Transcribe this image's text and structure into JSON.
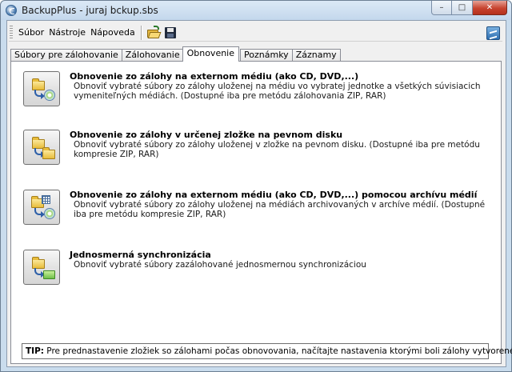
{
  "window": {
    "title": "BackupPlus - juraj bckup.sbs",
    "minimize_label": "–",
    "maximize_label": "□",
    "close_label": "✕"
  },
  "menu": {
    "items": [
      "Súbor",
      "Nástroje",
      "Nápoveda"
    ]
  },
  "toolbar": {
    "icons": [
      "open-folder-icon",
      "save-disk-icon",
      "brand-icon"
    ]
  },
  "tabs": [
    {
      "label": "Súbory pre zálohovanie",
      "active": false
    },
    {
      "label": "Zálohovanie",
      "active": false
    },
    {
      "label": "Obnovenie",
      "active": true
    },
    {
      "label": "Poznámky",
      "active": false
    },
    {
      "label": "Záznamy",
      "active": false
    }
  ],
  "options": [
    {
      "title": "Obnovenie zo zálohy na externom médiu (ako CD, DVD,...)",
      "description": "Obnoviť vybraté súbory zo zálohy uloženej na médiu vo vybratej jednotke a všetkých súvisiacich vymeniteľných médiách. (Dostupné iba pre metódu zálohovania ZIP, RAR)",
      "icon": "restore-from-media-icon"
    },
    {
      "title": "Obnovenie zo zálohy v určenej zložke na pevnom disku",
      "description": "Obnoviť vybraté súbory zo zálohy uloženej v zložke na pevnom disku. (Dostupné iba pre metódu kompresie ZIP, RAR)",
      "icon": "restore-from-folder-icon"
    },
    {
      "title": "Obnovenie zo zálohy na externom médiu (ako CD, DVD,...) pomocou archívu médií",
      "description": "Obnoviť vybraté súbory zo zálohy uloženej na médiách archivovaných v archíve médií. (Dostupné iba pre metódu kompresie ZIP, RAR)",
      "icon": "restore-media-archive-icon"
    },
    {
      "title": "Jednosmerná synchronizácia",
      "description": "Obnoviť vybraté súbory zazálohované jednosmernou synchronizáciou",
      "icon": "one-way-sync-icon"
    }
  ],
  "tip": {
    "label": "TIP:",
    "text": " Pre prednastavenie zložiek so zálohami počas obnovovania, načítajte nastavenia ktorými boli zálohy vytvorené"
  }
}
